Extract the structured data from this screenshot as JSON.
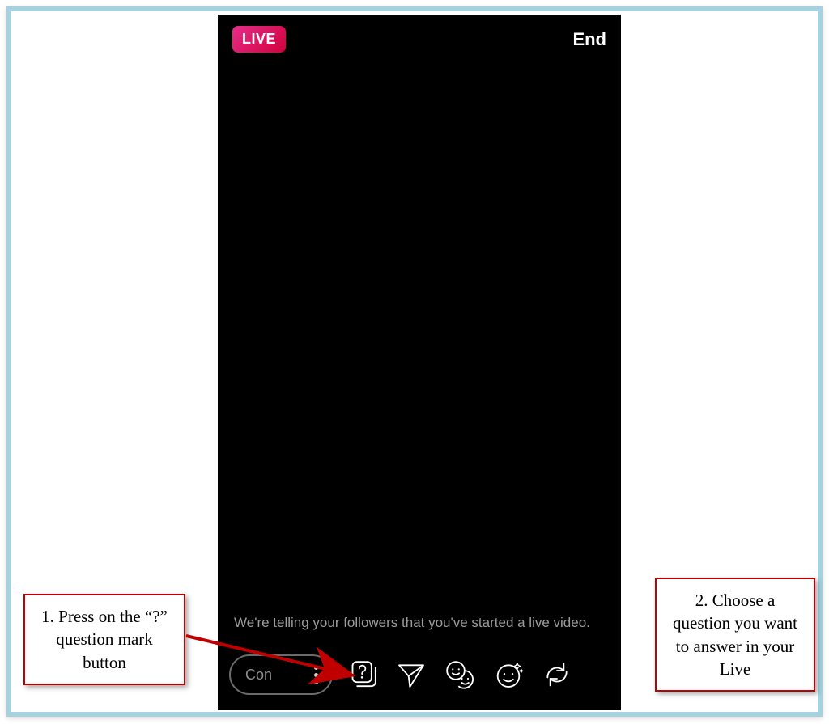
{
  "phone": {
    "live_badge": "LIVE",
    "end_label": "End",
    "status_text": "We're telling your followers that you've started a live video.",
    "comment_placeholder": "Con"
  },
  "callouts": {
    "left": "1. Press on the “?” question mark button",
    "right": "2. Choose a question you want to answer in your Live"
  }
}
